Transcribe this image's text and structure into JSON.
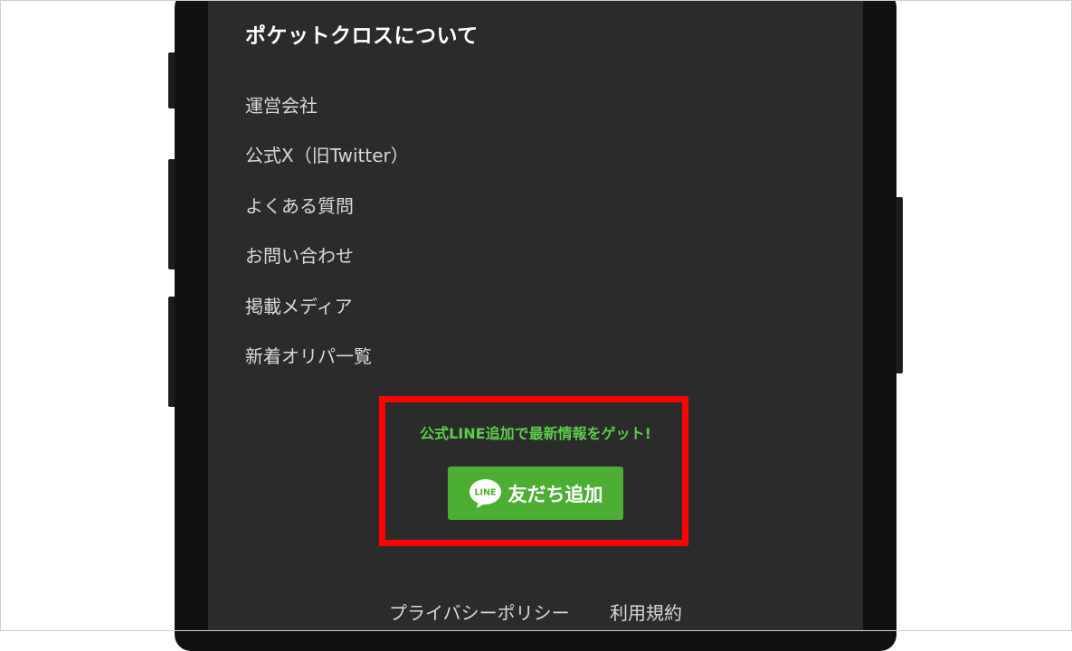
{
  "section": {
    "title": "ポケットクロスについて"
  },
  "menu": {
    "items": [
      {
        "label": "運営会社"
      },
      {
        "label": "公式X（旧Twitter）"
      },
      {
        "label": "よくある質問"
      },
      {
        "label": "お問い合わせ"
      },
      {
        "label": "掲載メディア"
      },
      {
        "label": "新着オリパ一覧"
      }
    ]
  },
  "line_promo": {
    "text": "公式LINE追加で最新情報をゲット!",
    "button_label": "友だち追加",
    "icon": "line-logo-icon",
    "icon_text": "LINE",
    "color": "#5ccc4b",
    "button_color": "#4caf33",
    "highlight_color": "#ff0000"
  },
  "footer": {
    "links": [
      {
        "label": "プライバシーポリシー"
      },
      {
        "label": "利用規約"
      }
    ]
  }
}
